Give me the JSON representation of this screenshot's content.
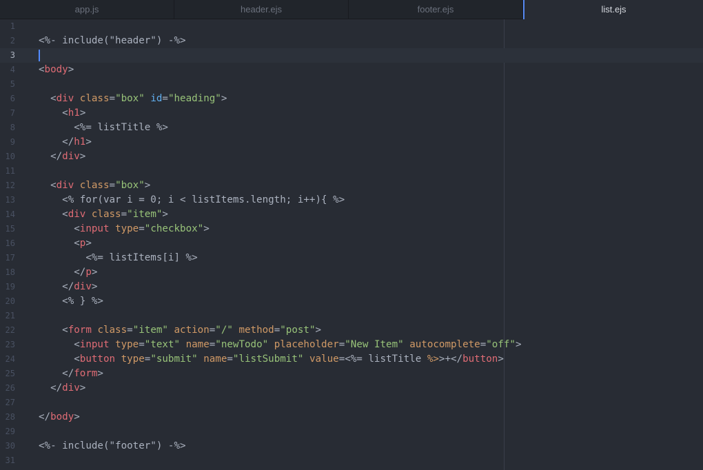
{
  "tabs": [
    {
      "label": "app.js",
      "active": false
    },
    {
      "label": "header.ejs",
      "active": false
    },
    {
      "label": "footer.ejs",
      "active": false
    },
    {
      "label": "list.ejs",
      "active": true
    }
  ],
  "editor": {
    "current_line": 3,
    "colors": {
      "background": "#282c34",
      "tag": "#e06c75",
      "attribute": "#d19a66",
      "id_attribute": "#61afef",
      "string": "#98c379",
      "cursor": "#528bff"
    },
    "lines": [
      {
        "n": "1",
        "tokens": []
      },
      {
        "n": "2",
        "tokens": [
          {
            "t": "<%- include(\"header\") -%>",
            "k": "ejs"
          }
        ]
      },
      {
        "n": "3",
        "tokens": []
      },
      {
        "n": "4",
        "tokens": [
          {
            "t": "<",
            "k": "punc"
          },
          {
            "t": "body",
            "k": "tag"
          },
          {
            "t": ">",
            "k": "punc"
          }
        ]
      },
      {
        "n": "5",
        "tokens": []
      },
      {
        "n": "6",
        "tokens": [
          {
            "t": "  <",
            "k": "punc"
          },
          {
            "t": "div",
            "k": "tag"
          },
          {
            "t": " ",
            "k": "punc"
          },
          {
            "t": "class",
            "k": "attr"
          },
          {
            "t": "=",
            "k": "punc"
          },
          {
            "t": "\"box\"",
            "k": "str"
          },
          {
            "t": " ",
            "k": "punc"
          },
          {
            "t": "id",
            "k": "id"
          },
          {
            "t": "=",
            "k": "punc"
          },
          {
            "t": "\"heading\"",
            "k": "str"
          },
          {
            "t": ">",
            "k": "punc"
          }
        ]
      },
      {
        "n": "7",
        "tokens": [
          {
            "t": "    <",
            "k": "punc"
          },
          {
            "t": "h1",
            "k": "tag"
          },
          {
            "t": ">",
            "k": "punc"
          }
        ]
      },
      {
        "n": "8",
        "tokens": [
          {
            "t": "      <%= listTitle %>",
            "k": "ejs"
          }
        ]
      },
      {
        "n": "9",
        "tokens": [
          {
            "t": "    </",
            "k": "punc"
          },
          {
            "t": "h1",
            "k": "tag"
          },
          {
            "t": ">",
            "k": "punc"
          }
        ]
      },
      {
        "n": "10",
        "tokens": [
          {
            "t": "  </",
            "k": "punc"
          },
          {
            "t": "div",
            "k": "tag"
          },
          {
            "t": ">",
            "k": "punc"
          }
        ]
      },
      {
        "n": "11",
        "tokens": []
      },
      {
        "n": "12",
        "tokens": [
          {
            "t": "  <",
            "k": "punc"
          },
          {
            "t": "div",
            "k": "tag"
          },
          {
            "t": " ",
            "k": "punc"
          },
          {
            "t": "class",
            "k": "attr"
          },
          {
            "t": "=",
            "k": "punc"
          },
          {
            "t": "\"box\"",
            "k": "str"
          },
          {
            "t": ">",
            "k": "punc"
          }
        ]
      },
      {
        "n": "13",
        "tokens": [
          {
            "t": "    <% for(var i = 0; i < listItems.length; i++){ %>",
            "k": "ejs"
          }
        ]
      },
      {
        "n": "14",
        "tokens": [
          {
            "t": "    <",
            "k": "punc"
          },
          {
            "t": "div",
            "k": "tag"
          },
          {
            "t": " ",
            "k": "punc"
          },
          {
            "t": "class",
            "k": "attr"
          },
          {
            "t": "=",
            "k": "punc"
          },
          {
            "t": "\"item\"",
            "k": "str"
          },
          {
            "t": ">",
            "k": "punc"
          }
        ]
      },
      {
        "n": "15",
        "tokens": [
          {
            "t": "      <",
            "k": "punc"
          },
          {
            "t": "input",
            "k": "tag"
          },
          {
            "t": " ",
            "k": "punc"
          },
          {
            "t": "type",
            "k": "attr"
          },
          {
            "t": "=",
            "k": "punc"
          },
          {
            "t": "\"checkbox\"",
            "k": "str"
          },
          {
            "t": ">",
            "k": "punc"
          }
        ]
      },
      {
        "n": "16",
        "tokens": [
          {
            "t": "      <",
            "k": "punc"
          },
          {
            "t": "p",
            "k": "tag"
          },
          {
            "t": ">",
            "k": "punc"
          }
        ]
      },
      {
        "n": "17",
        "tokens": [
          {
            "t": "        <%= listItems[i] %>",
            "k": "ejs"
          }
        ]
      },
      {
        "n": "18",
        "tokens": [
          {
            "t": "      </",
            "k": "punc"
          },
          {
            "t": "p",
            "k": "tag"
          },
          {
            "t": ">",
            "k": "punc"
          }
        ]
      },
      {
        "n": "19",
        "tokens": [
          {
            "t": "    </",
            "k": "punc"
          },
          {
            "t": "div",
            "k": "tag"
          },
          {
            "t": ">",
            "k": "punc"
          }
        ]
      },
      {
        "n": "20",
        "tokens": [
          {
            "t": "    <% } %>",
            "k": "ejs"
          }
        ]
      },
      {
        "n": "21",
        "tokens": []
      },
      {
        "n": "22",
        "tokens": [
          {
            "t": "    <",
            "k": "punc"
          },
          {
            "t": "form",
            "k": "tag"
          },
          {
            "t": " ",
            "k": "punc"
          },
          {
            "t": "class",
            "k": "attr"
          },
          {
            "t": "=",
            "k": "punc"
          },
          {
            "t": "\"item\"",
            "k": "str"
          },
          {
            "t": " ",
            "k": "punc"
          },
          {
            "t": "action",
            "k": "attr"
          },
          {
            "t": "=",
            "k": "punc"
          },
          {
            "t": "\"/\"",
            "k": "str"
          },
          {
            "t": " ",
            "k": "punc"
          },
          {
            "t": "method",
            "k": "attr"
          },
          {
            "t": "=",
            "k": "punc"
          },
          {
            "t": "\"post\"",
            "k": "str"
          },
          {
            "t": ">",
            "k": "punc"
          }
        ]
      },
      {
        "n": "23",
        "tokens": [
          {
            "t": "      <",
            "k": "punc"
          },
          {
            "t": "input",
            "k": "tag"
          },
          {
            "t": " ",
            "k": "punc"
          },
          {
            "t": "type",
            "k": "attr"
          },
          {
            "t": "=",
            "k": "punc"
          },
          {
            "t": "\"text\"",
            "k": "str"
          },
          {
            "t": " ",
            "k": "punc"
          },
          {
            "t": "name",
            "k": "attr"
          },
          {
            "t": "=",
            "k": "punc"
          },
          {
            "t": "\"newTodo\"",
            "k": "str"
          },
          {
            "t": " ",
            "k": "punc"
          },
          {
            "t": "placeholder",
            "k": "attr"
          },
          {
            "t": "=",
            "k": "punc"
          },
          {
            "t": "\"New Item\"",
            "k": "str"
          },
          {
            "t": " ",
            "k": "punc"
          },
          {
            "t": "autocomplete",
            "k": "attr"
          },
          {
            "t": "=",
            "k": "punc"
          },
          {
            "t": "\"off\"",
            "k": "str"
          },
          {
            "t": ">",
            "k": "punc"
          }
        ]
      },
      {
        "n": "24",
        "tokens": [
          {
            "t": "      <",
            "k": "punc"
          },
          {
            "t": "button",
            "k": "tag"
          },
          {
            "t": " ",
            "k": "punc"
          },
          {
            "t": "type",
            "k": "attr"
          },
          {
            "t": "=",
            "k": "punc"
          },
          {
            "t": "\"submit\"",
            "k": "str"
          },
          {
            "t": " ",
            "k": "punc"
          },
          {
            "t": "name",
            "k": "attr"
          },
          {
            "t": "=",
            "k": "punc"
          },
          {
            "t": "\"listSubmit\"",
            "k": "str"
          },
          {
            "t": " ",
            "k": "punc"
          },
          {
            "t": "value",
            "k": "attr"
          },
          {
            "t": "=<%= listTitle ",
            "k": "punc"
          },
          {
            "t": "%>",
            "k": "attr"
          },
          {
            "t": ">+</",
            "k": "punc"
          },
          {
            "t": "button",
            "k": "tag"
          },
          {
            "t": ">",
            "k": "punc"
          }
        ]
      },
      {
        "n": "25",
        "tokens": [
          {
            "t": "    </",
            "k": "punc"
          },
          {
            "t": "form",
            "k": "tag"
          },
          {
            "t": ">",
            "k": "punc"
          }
        ]
      },
      {
        "n": "26",
        "tokens": [
          {
            "t": "  </",
            "k": "punc"
          },
          {
            "t": "div",
            "k": "tag"
          },
          {
            "t": ">",
            "k": "punc"
          }
        ]
      },
      {
        "n": "27",
        "tokens": []
      },
      {
        "n": "28",
        "tokens": [
          {
            "t": "</",
            "k": "punc"
          },
          {
            "t": "body",
            "k": "tag"
          },
          {
            "t": ">",
            "k": "punc"
          }
        ]
      },
      {
        "n": "29",
        "tokens": []
      },
      {
        "n": "30",
        "tokens": [
          {
            "t": "<%- include(\"footer\") -%>",
            "k": "ejs"
          }
        ]
      },
      {
        "n": "31",
        "tokens": []
      }
    ]
  }
}
